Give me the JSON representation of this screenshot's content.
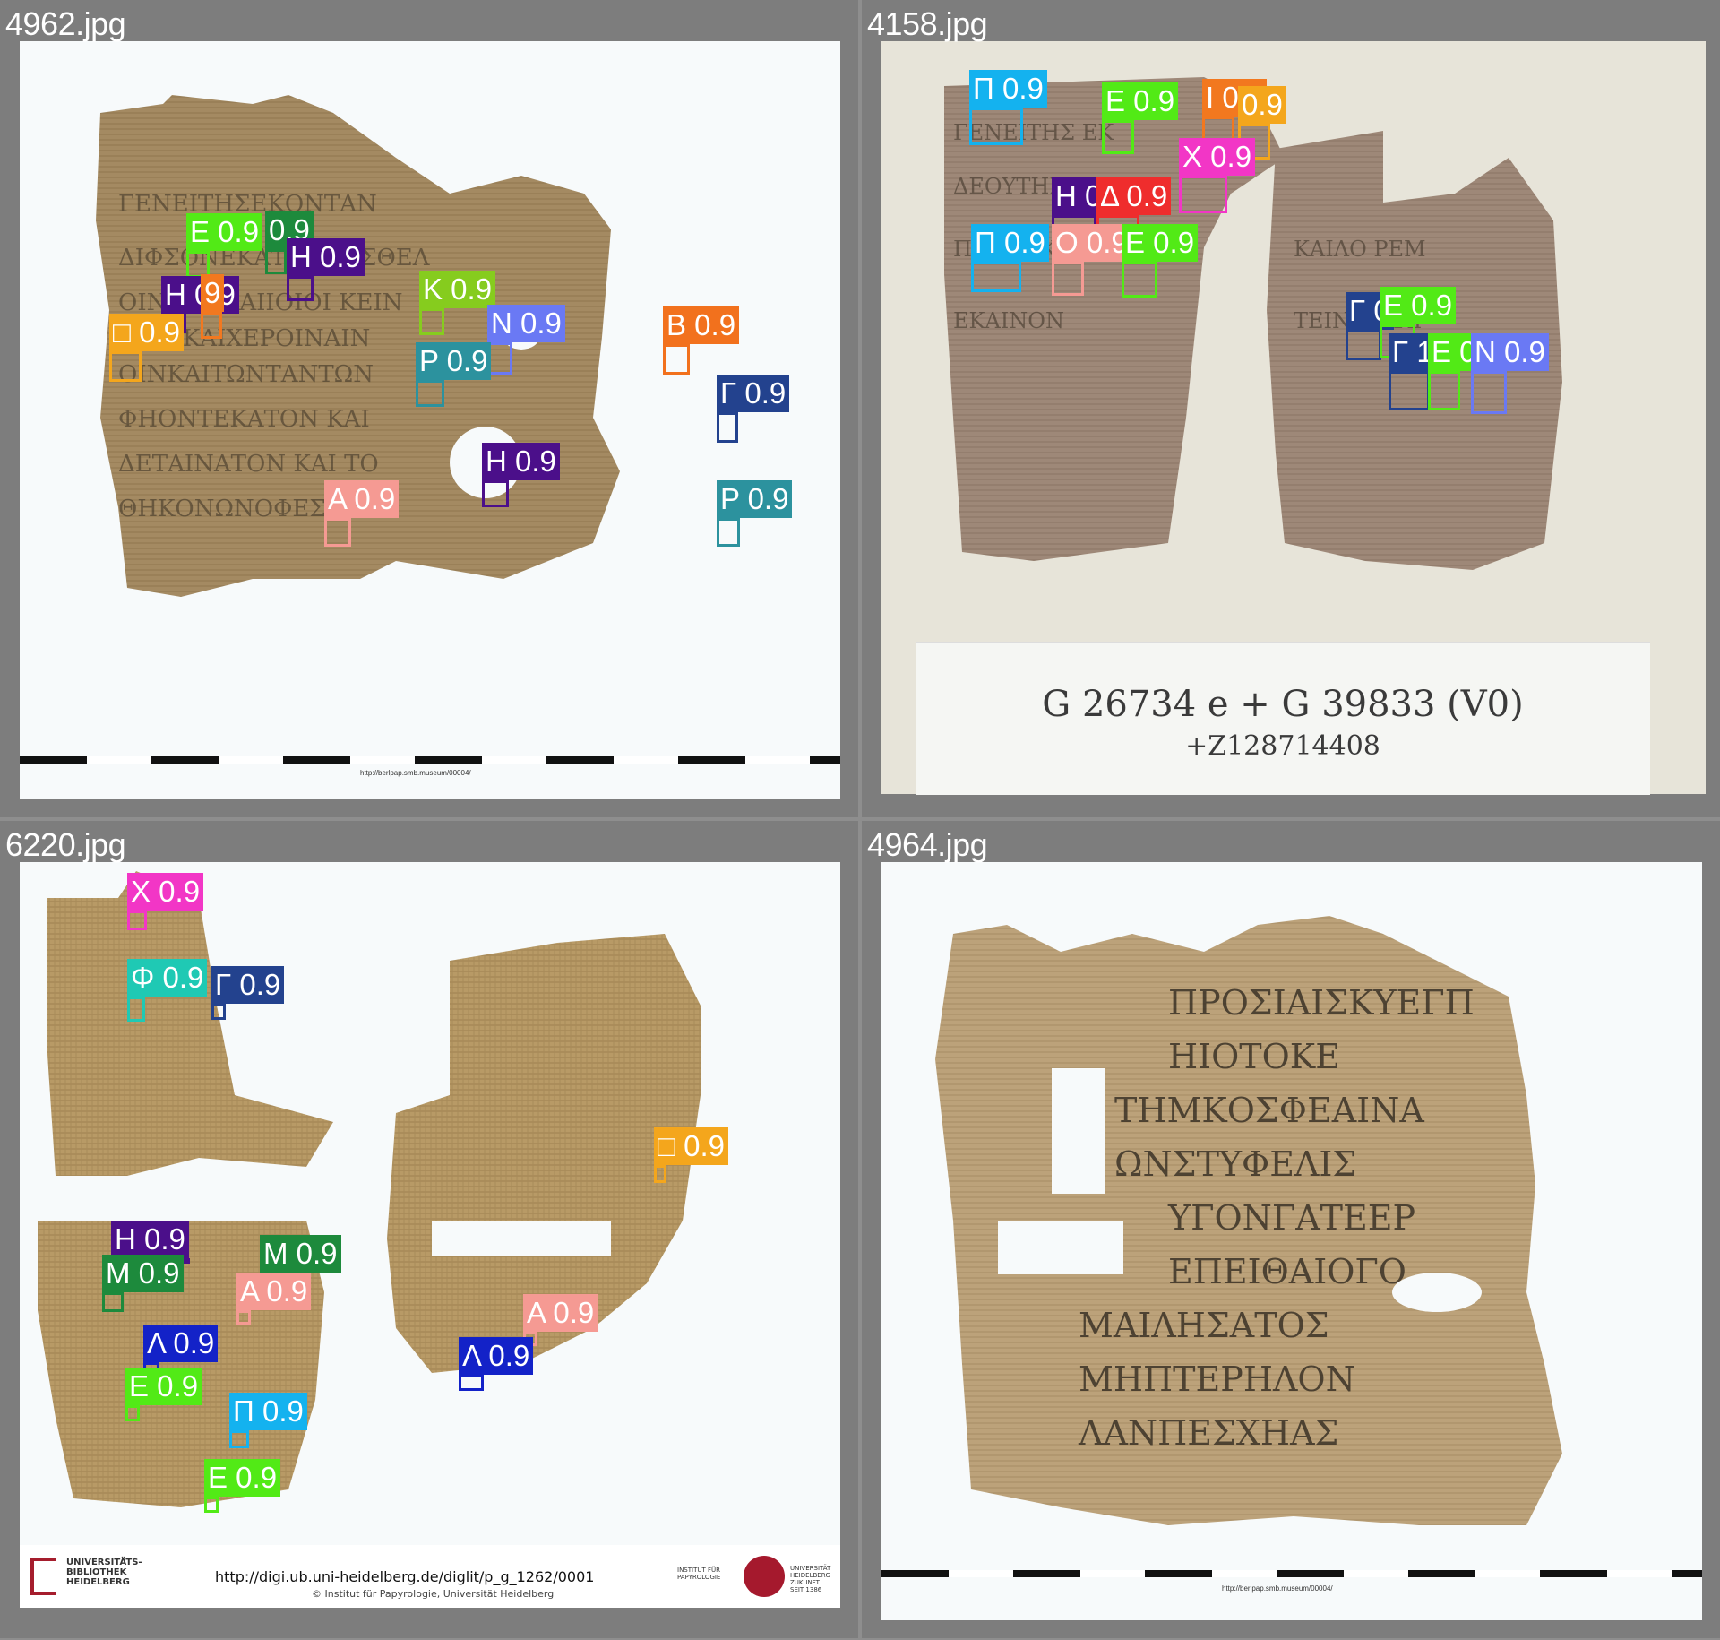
{
  "panels": [
    {
      "filename": "4962.jpg",
      "footer_url": "http://berlpap.smb.museum/00004/",
      "detections": [
        {
          "label": "Ε 0.9",
          "color": "#52ea16"
        },
        {
          "label": "0.9",
          "color": "#1d8a3c"
        },
        {
          "label": "Η 0.9",
          "color": "#4b0f8a"
        },
        {
          "label": "Η 0.9",
          "color": "#4b0f8a"
        },
        {
          "label": "9",
          "color": "#f2781f"
        },
        {
          "label": "□ 0.9",
          "color": "#f4a61c"
        },
        {
          "label": "Κ 0.9",
          "color": "#86cc1e"
        },
        {
          "label": "Ν 0.9",
          "color": "#6a79f4"
        },
        {
          "label": "Ρ 0.9",
          "color": "#2c929e"
        },
        {
          "label": "Β 0.9",
          "color": "#f2711d"
        },
        {
          "label": "Γ 0.9",
          "color": "#23428e"
        },
        {
          "label": "Η 0.9",
          "color": "#4b0f8a"
        },
        {
          "label": "Α 0.9",
          "color": "#f59a93"
        },
        {
          "label": "Ρ 0.9",
          "color": "#2c929e"
        }
      ]
    },
    {
      "filename": "4158.jpg",
      "catalog_id": "G 26734 e + G 39833 (V0)",
      "catalog_sub": "+Z128714408",
      "detections": [
        {
          "label": "Π 0.9",
          "color": "#14b2ef"
        },
        {
          "label": "Ε 0.9",
          "color": "#52ea16"
        },
        {
          "label": "Ι 0.9",
          "color": "#f2781f"
        },
        {
          "label": "0.9",
          "color": "#f4a61c"
        },
        {
          "label": "Χ 0.9",
          "color": "#f236c6"
        },
        {
          "label": "Η 0",
          "color": "#4b0f8a"
        },
        {
          "label": "Δ 0.9",
          "color": "#ef2d2d"
        },
        {
          "label": "Π 0.9",
          "color": "#14b2ef"
        },
        {
          "label": "Ο 0.9",
          "color": "#f59a93"
        },
        {
          "label": "Ε 0.9",
          "color": "#52ea16"
        },
        {
          "label": "Γ 0",
          "color": "#23428e"
        },
        {
          "label": "Ε 0.9",
          "color": "#52ea16"
        },
        {
          "label": "Γ 1",
          "color": "#23428e"
        },
        {
          "label": "Ε 0",
          "color": "#52ea16"
        },
        {
          "label": "Ν 0.9",
          "color": "#6a79f4"
        }
      ]
    },
    {
      "filename": "6220.jpg",
      "footer": {
        "library": "UNIVERSITÄTS-\nBIBLIOTHEK\nHEIDELBERG",
        "url": "http://digi.ub.uni-heidelberg.de/diglit/p_g_1262/0001",
        "copyright": "© Institut für Papyrologie, Universität Heidelberg",
        "institute": "INSTITUT FÜR\nPAPYROLOGIE",
        "university": "UNIVERSITÄT\nHEIDELBERG\nZUKUNFT\nSEIT 1386"
      },
      "detections": [
        {
          "label": "Χ 0.9",
          "color": "#f236c6"
        },
        {
          "label": "Φ 0.9",
          "color": "#1fc9b4"
        },
        {
          "label": "Γ 0.9",
          "color": "#23428e"
        },
        {
          "label": "□ 0.9",
          "color": "#f4a61c"
        },
        {
          "label": "Η 0.9",
          "color": "#4b0f8a"
        },
        {
          "label": "Μ 0.9",
          "color": "#1d8a3c"
        },
        {
          "label": "Μ 0.9",
          "color": "#1d8a3c"
        },
        {
          "label": "Α 0.9",
          "color": "#f59a93"
        },
        {
          "label": "Λ 0.9",
          "color": "#1322c8"
        },
        {
          "label": "Ε 0.9",
          "color": "#52ea16"
        },
        {
          "label": "Π 0.9",
          "color": "#14b2ef"
        },
        {
          "label": "Ε 0.9",
          "color": "#52ea16"
        },
        {
          "label": "Α 0.9",
          "color": "#f59a93"
        },
        {
          "label": "Λ 0.9",
          "color": "#1322c8"
        }
      ]
    },
    {
      "filename": "4964.jpg",
      "footer_url": "http://berlpap.smb.museum/00004/",
      "detections": []
    }
  ]
}
